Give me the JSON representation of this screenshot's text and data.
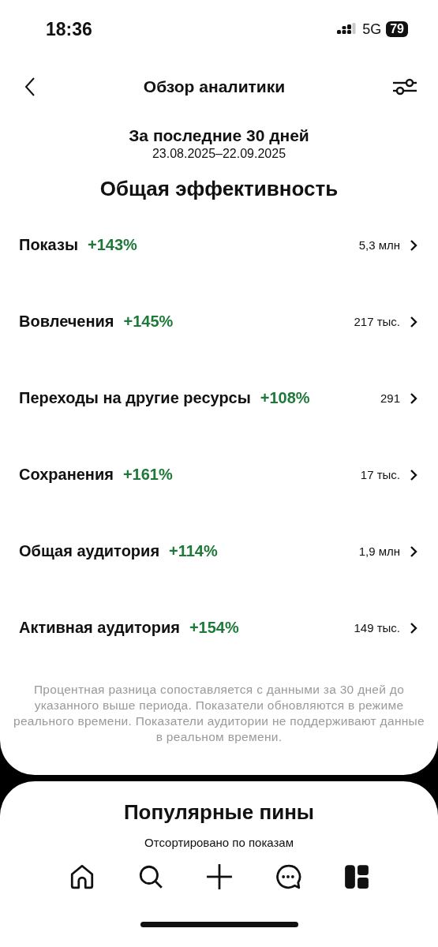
{
  "status_bar": {
    "time": "18:36",
    "network": "5G",
    "battery": "79"
  },
  "header": {
    "title": "Обзор аналитики"
  },
  "period": {
    "title": "За последние 30 дней",
    "dates": "23.08.2025–22.09.2025"
  },
  "section_title": "Общая эффективность",
  "metrics": [
    {
      "name": "Показы",
      "change": "+143%",
      "value": "5,3 млн"
    },
    {
      "name": "Вовлечения",
      "change": "+145%",
      "value": "217 тыс."
    },
    {
      "name": "Переходы на другие ресурсы",
      "change": "+108%",
      "value": "291"
    },
    {
      "name": "Сохранения",
      "change": "+161%",
      "value": "17 тыс."
    },
    {
      "name": "Общая аудитория",
      "change": "+114%",
      "value": "1,9 млн"
    },
    {
      "name": "Активная аудитория",
      "change": "+154%",
      "value": "149 тыс."
    }
  ],
  "note": "Процентная разница сопоставляется с данными за 30 дней до указанного выше периода. Показатели обновляются в режиме реального времени. Показатели аудитории не поддерживают данные в реальном времени.",
  "popular": {
    "title": "Популярные пины",
    "subtitle": "Отсортировано по показам"
  },
  "nav": [
    {
      "kind": "home",
      "selected": false
    },
    {
      "kind": "search",
      "selected": false
    },
    {
      "kind": "create",
      "selected": false
    },
    {
      "kind": "messages",
      "selected": false
    },
    {
      "kind": "boards",
      "selected": true
    }
  ]
}
